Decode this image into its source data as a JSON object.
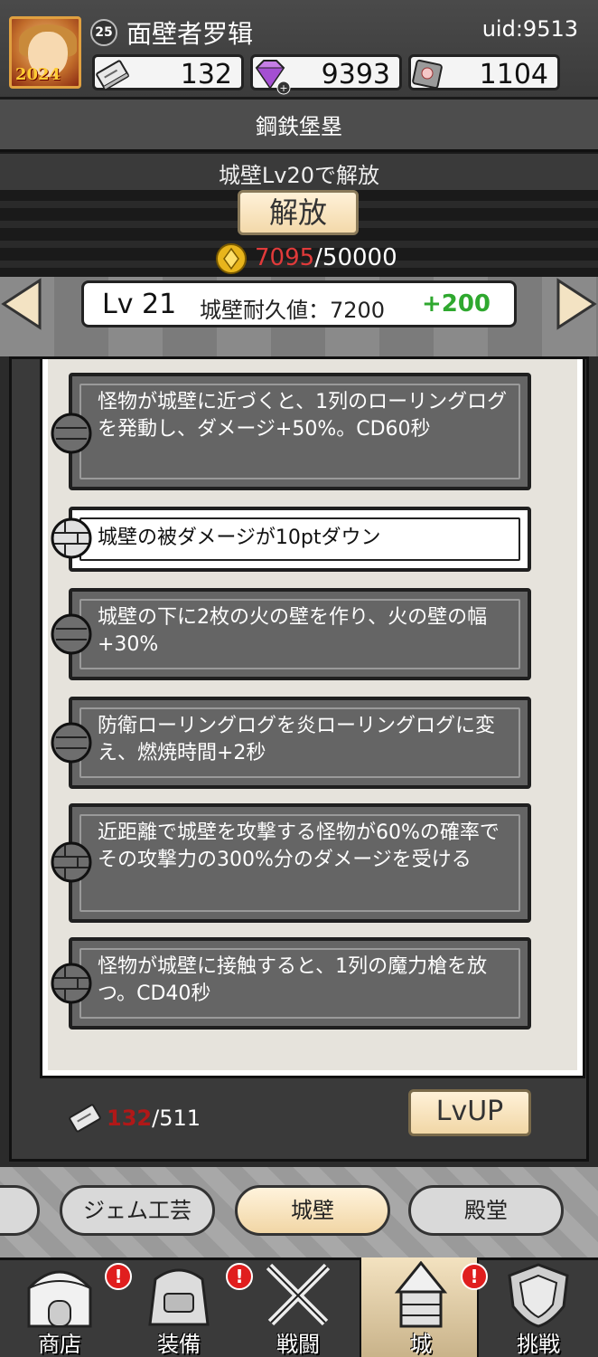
{
  "header": {
    "player_level": "25",
    "player_name": "面壁者罗辑",
    "uid": "uid:9513",
    "avatar_year": "2024",
    "resources": [
      {
        "icon": "skill-book-icon",
        "value": "132"
      },
      {
        "icon": "gem-icon",
        "value": "9393"
      },
      {
        "icon": "stone-icon",
        "value": "1104"
      }
    ]
  },
  "banner": {
    "title": "鋼鉄堡塁",
    "unlock_condition": "城壁Lv20で解放",
    "unlock_button": "解放",
    "coin_current": "7095",
    "coin_required": "/50000"
  },
  "level_bar": {
    "level": "Lv 21",
    "durability": "城壁耐久値：7200",
    "increase": "+200"
  },
  "skills": [
    {
      "text": "怪物が城壁に近づくと、1列のローリングログを発動し、ダメージ+50%。CD60秒",
      "active": false
    },
    {
      "text": "城壁の被ダメージが10ptダウン",
      "active": true
    },
    {
      "text": "城壁の下に2枚の火の壁を作り、火の壁の幅+30%",
      "active": false
    },
    {
      "text": "防衛ローリングログを炎ローリングログに変え、燃焼時間+2秒",
      "active": false
    },
    {
      "text": "近距離で城壁を攻撃する怪物が60%の確率でその攻撃力の300%分のダメージを受ける",
      "active": false
    },
    {
      "text": "怪物が城壁に接触すると、1列の魔力槍を放つ。CD40秒",
      "active": false
    }
  ],
  "footer": {
    "book_current": "132",
    "book_required": "/511",
    "lvup_button": "LvUP"
  },
  "tabs": [
    {
      "label": "ジェム工芸",
      "selected": false
    },
    {
      "label": "城壁",
      "selected": true
    },
    {
      "label": "殿堂",
      "selected": false
    }
  ],
  "nav": [
    {
      "label": "商店",
      "icon": "shop-icon",
      "alert": "!"
    },
    {
      "label": "装備",
      "icon": "equipment-bag-icon",
      "alert": "!"
    },
    {
      "label": "戦闘",
      "icon": "crossed-swords-icon",
      "alert": ""
    },
    {
      "label": "城",
      "icon": "castle-tower-icon",
      "alert": "!"
    },
    {
      "label": "挑戦",
      "icon": "shield-icon",
      "alert": ""
    }
  ],
  "colors": {
    "coin_current": "#e03a3a",
    "durability_increase": "#2fa82f",
    "alert_badge": "#e01e1e",
    "book_current": "#b01818"
  }
}
